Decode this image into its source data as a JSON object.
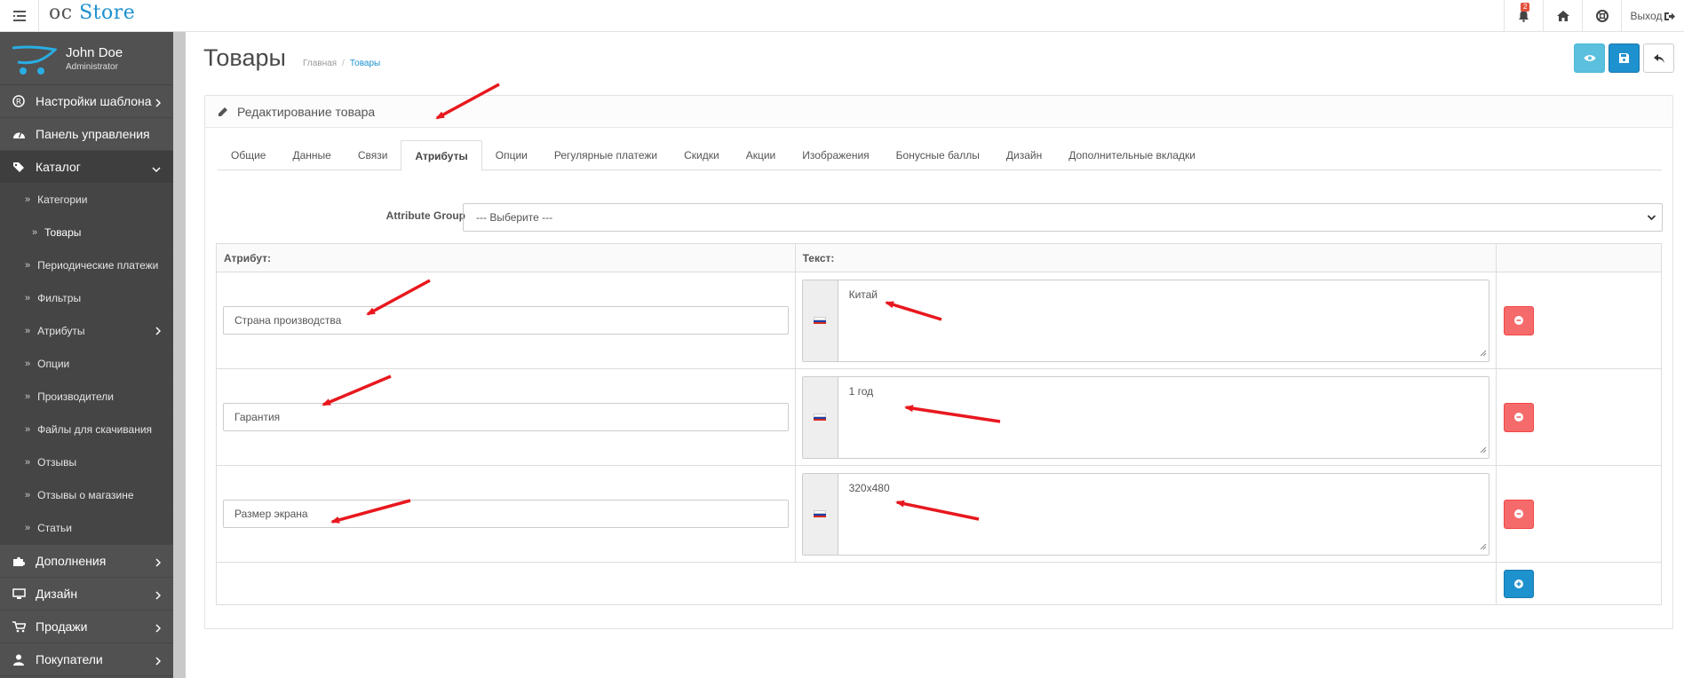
{
  "header": {
    "logo_oc": "oc",
    "logo_store": "Store",
    "notifications_count": "2",
    "logout_label": "Выход"
  },
  "profile": {
    "name": "John Doe",
    "role": "Administrator"
  },
  "sidebar": {
    "items": [
      {
        "label": "Настройки шаблона"
      },
      {
        "label": "Панель управления"
      },
      {
        "label": "Каталог"
      },
      {
        "label": "Категории"
      },
      {
        "label": "Товары"
      },
      {
        "label": "Периодические платежи"
      },
      {
        "label": "Фильтры"
      },
      {
        "label": "Атрибуты"
      },
      {
        "label": "Опции"
      },
      {
        "label": "Производители"
      },
      {
        "label": "Файлы для скачивания"
      },
      {
        "label": "Отзывы"
      },
      {
        "label": "Отзывы о магазине"
      },
      {
        "label": "Статьи"
      },
      {
        "label": "Дополнения"
      },
      {
        "label": "Дизайн"
      },
      {
        "label": "Продажи"
      },
      {
        "label": "Покупатели"
      }
    ]
  },
  "page": {
    "title": "Товары",
    "breadcrumb": [
      "Главная",
      "Товары"
    ],
    "panel_title": "Редактирование товара"
  },
  "tabs": [
    {
      "label": "Общие"
    },
    {
      "label": "Данные"
    },
    {
      "label": "Связи"
    },
    {
      "label": "Атрибуты"
    },
    {
      "label": "Опции"
    },
    {
      "label": "Регулярные платежи"
    },
    {
      "label": "Скидки"
    },
    {
      "label": "Акции"
    },
    {
      "label": "Изображения"
    },
    {
      "label": "Бонусные баллы"
    },
    {
      "label": "Дизайн"
    },
    {
      "label": "Дополнительные вкладки"
    }
  ],
  "form": {
    "attribute_group_label": "Attribute Group",
    "attribute_group_value": "--- Выберите ---"
  },
  "table": {
    "col_attribute": "Атрибут:",
    "col_text": "Текст:",
    "rows": [
      {
        "attribute": "Страна производства",
        "text": "Китай"
      },
      {
        "attribute": "Гарантия",
        "text": "1 год"
      },
      {
        "attribute": "Размер экрана",
        "text": "320x480"
      }
    ]
  },
  "colors": {
    "primary": "#1e91cf",
    "info": "#5bc0de",
    "danger": "#f56b6b",
    "sidebar_bg": "#515151",
    "annotation_arrow": "#e8181e"
  }
}
